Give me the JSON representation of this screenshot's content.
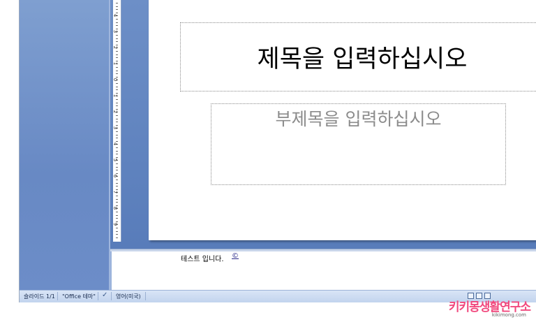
{
  "slide": {
    "title_placeholder": "제목을 입력하십시오",
    "subtitle_placeholder": "부제목을 입력하십시오"
  },
  "notes": {
    "text": "테스트 입니다.",
    "cursor_glyph": "©"
  },
  "ruler": {
    "numbers": [
      "4",
      "3",
      "2",
      "1",
      "0",
      "1",
      "2",
      "3",
      "4",
      "5",
      "6",
      "7",
      "8",
      "9"
    ]
  },
  "status_bar": {
    "slide_counter": "슬라이드 1/1",
    "theme": "\"Office 테마\"",
    "spellcheck_icon": "proofing-check-icon",
    "language": "영어(미국)",
    "view_buttons": [
      "normal-view-icon",
      "slide-sorter-icon",
      "slideshow-icon"
    ]
  },
  "watermark": {
    "main": "키키몽생활연구소",
    "url": "kikimong.com"
  },
  "colors": {
    "slides_pane": "#6f90c9",
    "work_area": "#5f82bf",
    "status_bar": "#cfdcf1",
    "watermark": "#f1497e"
  }
}
